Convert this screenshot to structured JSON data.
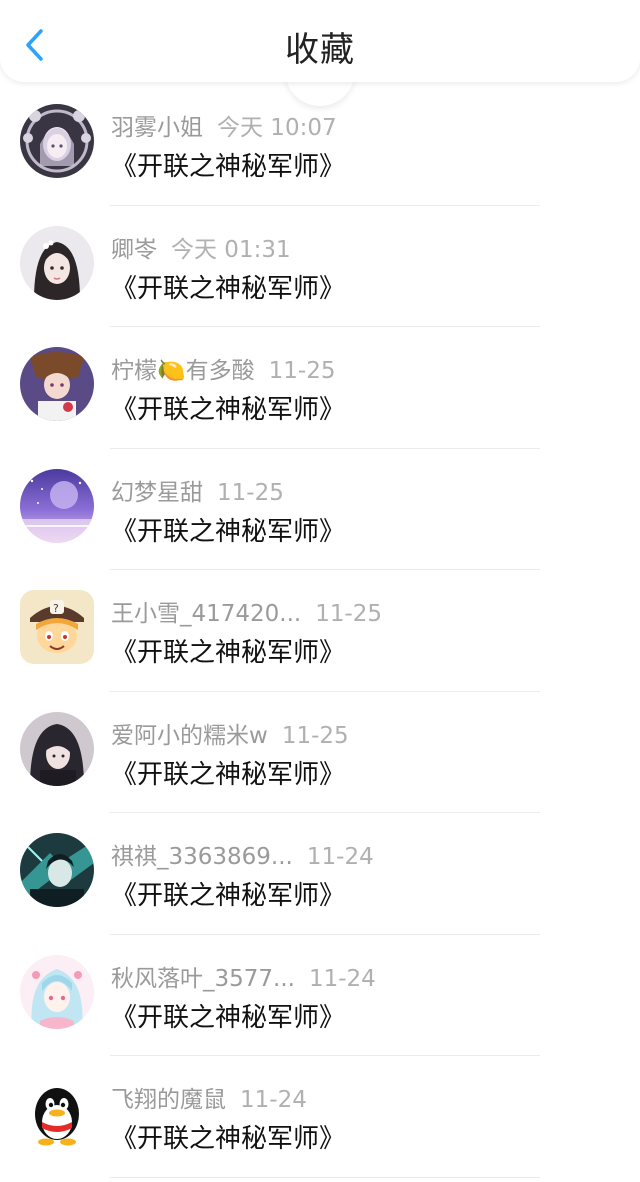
{
  "header": {
    "title": "收藏",
    "back_icon": "chevron-left-icon",
    "accent_color": "#2aa3ff"
  },
  "items": [
    {
      "name": "羽雾小姐",
      "time": "今天 10:07",
      "book": "《开联之神秘军师》",
      "avatar": "anime-girl-avatar"
    },
    {
      "name": "卿岺",
      "time": "今天 01:31",
      "book": "《开联之神秘军师》",
      "avatar": "anime-girl-avatar"
    },
    {
      "name": "柠檬🍋有多酸",
      "time": "11-25",
      "book": "《开联之神秘军师》",
      "avatar": "anime-girl-avatar"
    },
    {
      "name": "幻梦星甜",
      "time": "11-25",
      "book": "《开联之神秘军师》",
      "avatar": "starry-sky-avatar"
    },
    {
      "name": "王小雪_417420...",
      "time": "11-25",
      "book": "《开联之神秘军师》",
      "avatar": "cartoon-character-avatar"
    },
    {
      "name": "爱阿小的糯米w",
      "time": "11-25",
      "book": "《开联之神秘军师》",
      "avatar": "anime-boy-avatar"
    },
    {
      "name": "祺祺_3363869...",
      "time": "11-24",
      "book": "《开联之神秘军师》",
      "avatar": "anime-boy-avatar"
    },
    {
      "name": "秋风落叶_3577...",
      "time": "11-24",
      "book": "《开联之神秘军师》",
      "avatar": "anime-girl-avatar"
    },
    {
      "name": "飞翔的魔鼠",
      "time": "11-24",
      "book": "《开联之神秘军师》",
      "avatar": "qq-penguin-avatar"
    }
  ]
}
